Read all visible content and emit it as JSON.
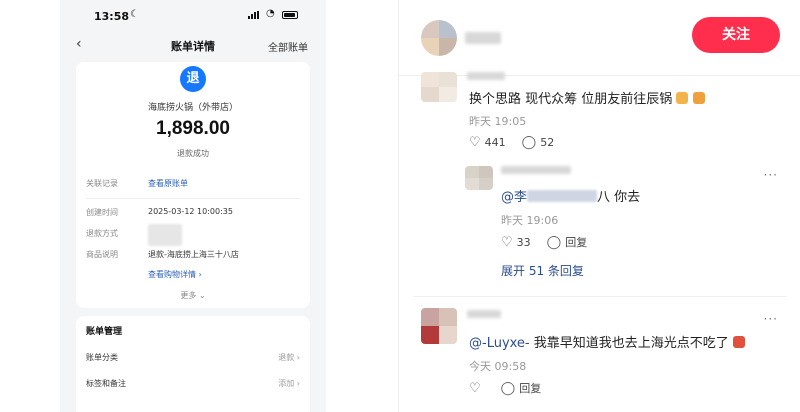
{
  "phone": {
    "status_time": "13:58",
    "nav": {
      "title": "账单详情",
      "all_bills": "全部账单"
    },
    "bill": {
      "icon_text": "退",
      "merchant": "海底捞火锅（外带店）",
      "amount": "1,898.00",
      "status": "退款成功",
      "related_label": "关联记录",
      "related_link": "查看原账单",
      "created_label": "创建时间",
      "created_value": "2025-03-12 10:00:35",
      "method_label": "退款方式",
      "desc_label": "商品说明",
      "desc_value": "退款-海底捞上海三十八店",
      "shopping_link": "查看购物详情 ›",
      "more": "更多 ⌄"
    },
    "manage": {
      "title": "账单管理",
      "category_label": "账单分类",
      "category_value": "退款 ›",
      "tags_label": "标签和备注",
      "tags_value": "添加 ›"
    }
  },
  "comments_panel": {
    "follow_label": "关注",
    "comments": [
      {
        "text": "换个思路 现代众筹  位朋友前往辰锅",
        "time": "昨天 19:05",
        "likes": "441",
        "replies": "52"
      },
      {
        "mention": "@李",
        "text_tail": "八 你去",
        "time": "昨天 19:06",
        "likes": "33",
        "reply_label": "回复",
        "expand": "展开 51 条回复"
      },
      {
        "mention": "@-Luyxe-",
        "text_tail": " 我靠早知道我也去上海光点不吃了",
        "time": "今天 09:58",
        "like_label": "",
        "reply_label": "回复"
      }
    ],
    "colors": {
      "accent": "#ff2e4d",
      "link": "#2b4d8f"
    }
  }
}
